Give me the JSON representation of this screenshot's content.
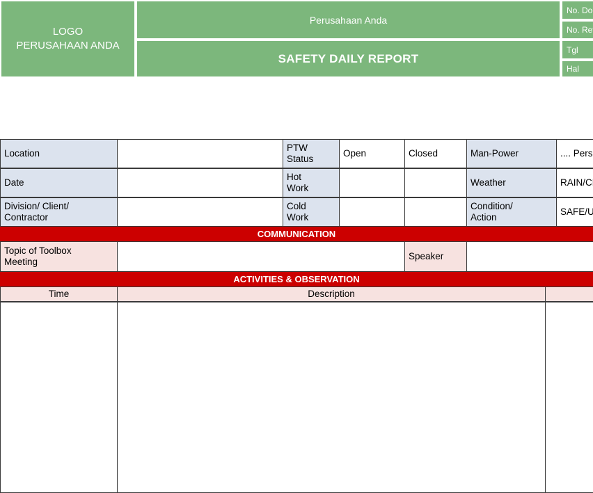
{
  "header": {
    "logo_line1": "LOGO",
    "logo_line2": "PERUSAHAAN ANDA",
    "company": "Perusahaan Anda",
    "title": "SAFETY  DAILY REPORT",
    "meta": [
      {
        "label": "No. Doc"
      },
      {
        "label": "No. Rev"
      },
      {
        "label": "Tgl"
      },
      {
        "label": "Hal"
      }
    ],
    "colors": {
      "green": "#7cb77c",
      "text": "#ffffff"
    }
  },
  "info_table": {
    "rows": [
      {
        "label": "Location",
        "value": "",
        "mid_label": "PTW\nStatus",
        "open": "Open",
        "closed": "Closed",
        "right_label": "Man-Power",
        "right_value": ".... Person"
      },
      {
        "label": "Date",
        "value": "",
        "mid_label": "Hot\nWork",
        "open": "",
        "closed": "",
        "right_label": "Weather",
        "right_value": "RAIN/CLOUDY"
      },
      {
        "label": "Division/ Client/\nContractor",
        "value": "",
        "mid_label": "Cold\nWork",
        "open": "",
        "closed": "",
        "right_label": "Condition/\nAction",
        "right_value": "SAFE/UNSAFE"
      }
    ]
  },
  "communication": {
    "banner": "COMMUNICATION",
    "topic_label": "Topic of Toolbox\nMeeting",
    "topic_value": "",
    "speaker_label": "Speaker",
    "speaker_value": ""
  },
  "activities": {
    "banner": "ACTIVITIES & OBSERVATION",
    "columns": {
      "time": "Time",
      "description": "Description",
      "extra": ""
    },
    "rows": []
  },
  "colors": {
    "banner_red": "#cc0000",
    "label_blue": "#dce3ee",
    "label_pink": "#f7e2e0",
    "grid_line": "#3a3a3a"
  }
}
